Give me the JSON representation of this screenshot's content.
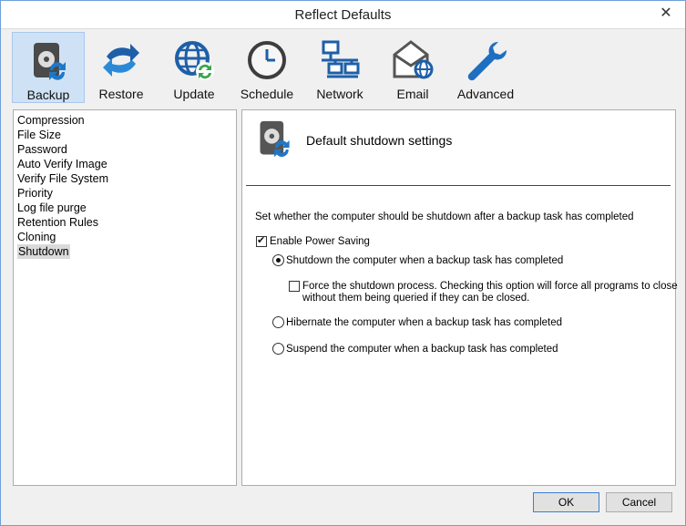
{
  "window": {
    "title": "Reflect Defaults",
    "close_glyph": "✕"
  },
  "toolbar": {
    "items": [
      {
        "label": "Backup",
        "icon": "backup-disk-icon",
        "active": true
      },
      {
        "label": "Restore",
        "icon": "restore-arrows-icon"
      },
      {
        "label": "Update",
        "icon": "update-globe-icon"
      },
      {
        "label": "Schedule",
        "icon": "clock-icon"
      },
      {
        "label": "Network",
        "icon": "network-icon"
      },
      {
        "label": "Email",
        "icon": "email-icon"
      },
      {
        "label": "Advanced",
        "icon": "wrench-icon"
      }
    ]
  },
  "nav": {
    "items": [
      "Compression",
      "File Size",
      "Password",
      "Auto Verify Image",
      "Verify File System",
      "Priority",
      "Log file purge",
      "Retention Rules",
      "Cloning",
      "Shutdown"
    ],
    "selected": "Shutdown"
  },
  "content": {
    "header_title": "Default shutdown settings",
    "description": "Set whether the computer should be shutdown after a backup task has completed",
    "enable_power_saving": {
      "label": "Enable Power Saving",
      "checked": true
    },
    "options": {
      "shutdown": {
        "label": "Shutdown the computer when a backup task has completed",
        "selected": true
      },
      "force_line1": "Force the shutdown process.  Checking this option will force all programs to close",
      "force_line2": "without them being queried if they can be closed.",
      "force_checked": false,
      "hibernate": {
        "label": "Hibernate the computer when a backup task has completed",
        "selected": false
      },
      "suspend": {
        "label": "Suspend the computer when a backup task has completed",
        "selected": false
      }
    }
  },
  "buttons": {
    "ok": "OK",
    "cancel": "Cancel"
  },
  "colors": {
    "accent": "#2b6cb8",
    "active_tab": "#cfe2f5",
    "title_bar": "#ffffff"
  }
}
